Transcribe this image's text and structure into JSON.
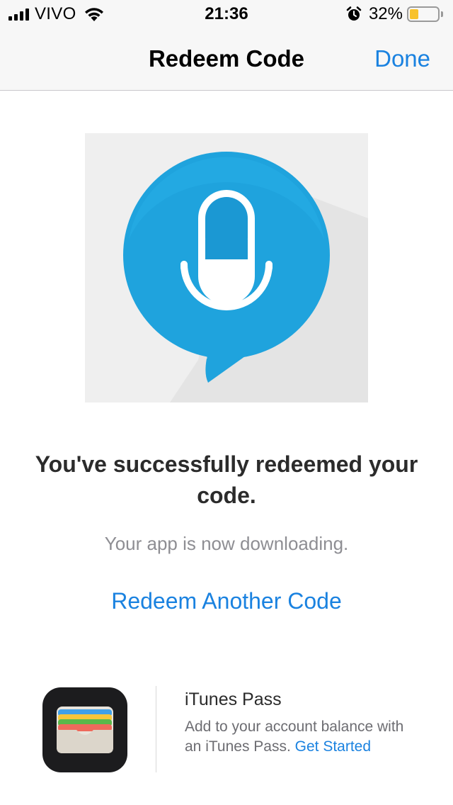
{
  "status_bar": {
    "carrier": "VIVO",
    "time": "21:36",
    "battery_percent": "32%",
    "battery_level": 0.32,
    "icons": [
      "signal-icon",
      "wifi-icon",
      "alarm-icon",
      "battery-icon"
    ]
  },
  "nav": {
    "title": "Redeem Code",
    "done_label": "Done"
  },
  "artwork": {
    "icon": "microphone-speech-bubble-icon",
    "bubble_color": "#1fa3dd"
  },
  "message": {
    "success": "You've successfully redeemed your code.",
    "subtext": "Your app is now downloading.",
    "redeem_another": "Redeem Another Code"
  },
  "promo": {
    "icon": "wallet-icon",
    "title": "iTunes Pass",
    "description": "Add to your account balance with an iTunes Pass.",
    "link": "Get Started"
  },
  "colors": {
    "accent": "#1a82e0",
    "nav_background": "#f7f7f7",
    "battery_fill": "#f8c22c"
  }
}
